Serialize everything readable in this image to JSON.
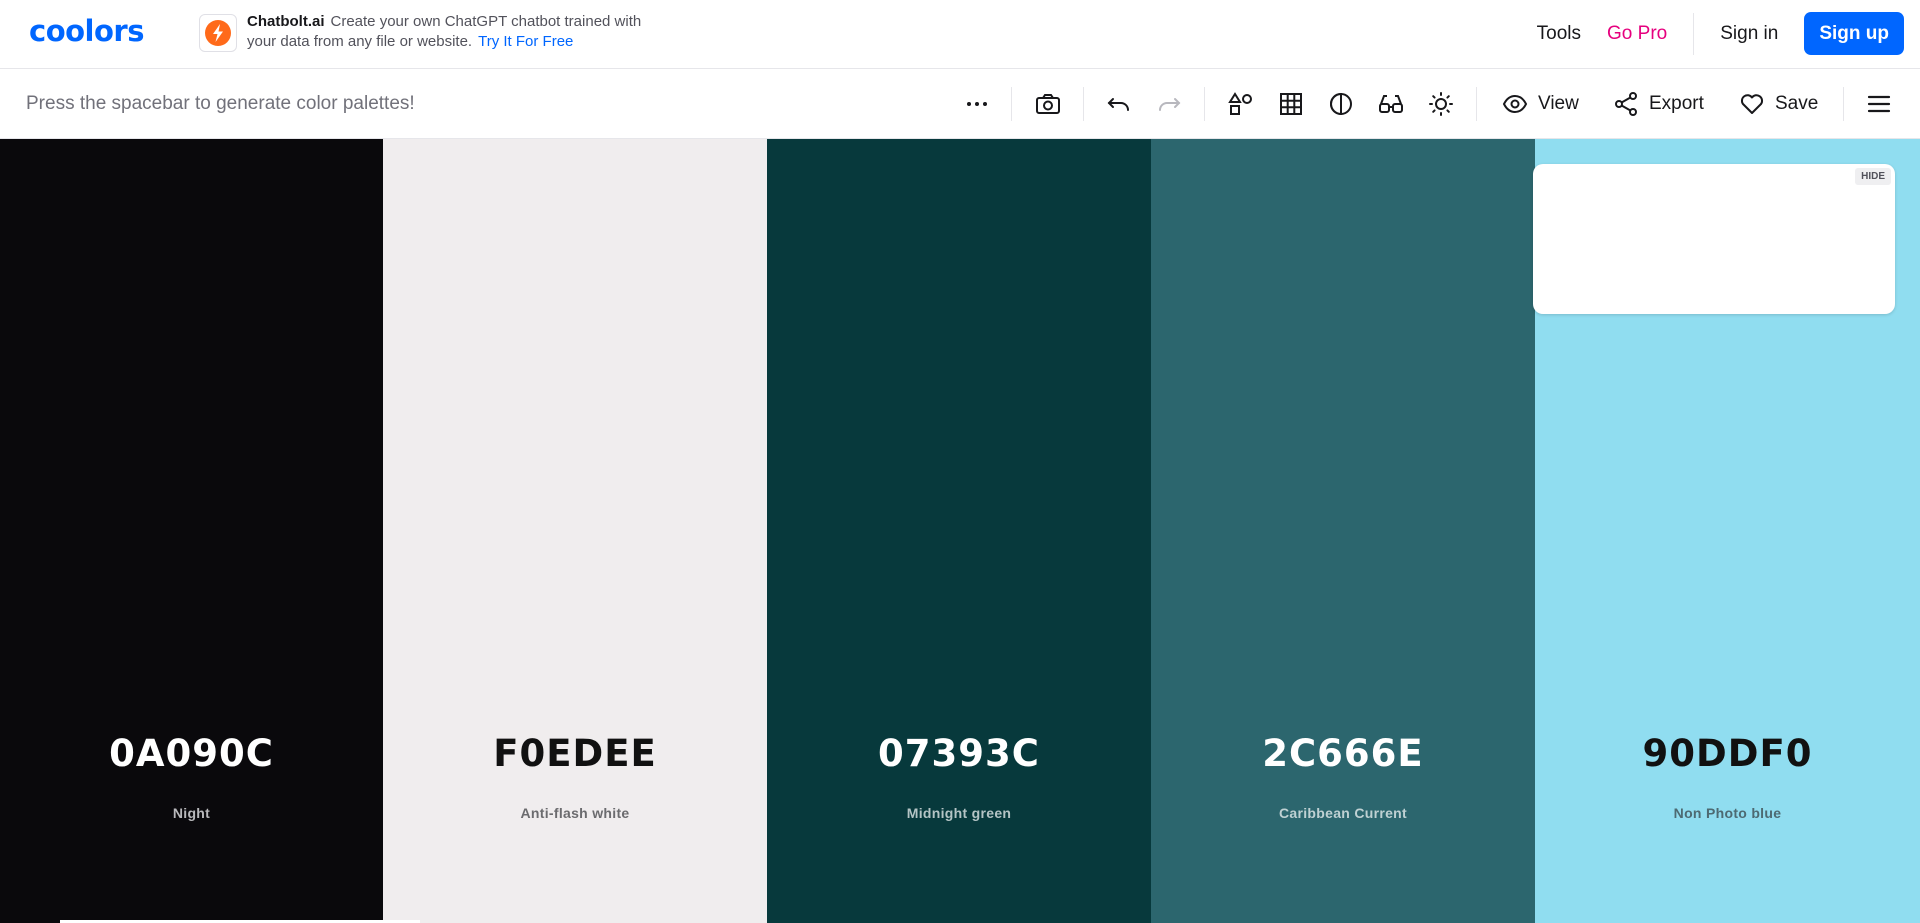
{
  "nav": {
    "logo": "coolors",
    "ad": {
      "brand": "Chatbolt.ai",
      "text": "Create your own ChatGPT chatbot trained with your data from any file or website.",
      "cta": "Try It For Free"
    },
    "tools_label": "Tools",
    "gopro_label": "Go Pro",
    "signin_label": "Sign in",
    "signup_label": "Sign up",
    "accent_color": "#0066ff",
    "pro_color": "#e6007e"
  },
  "toolbar": {
    "hint": "Press the spacebar to generate color palettes!",
    "view_label": "View",
    "export_label": "Export",
    "save_label": "Save",
    "icons": [
      "more-icon",
      "camera-icon",
      "undo-icon",
      "redo-icon",
      "shapes-icon",
      "grid-icon",
      "contrast-icon",
      "glasses-icon",
      "sun-icon",
      "eye-icon",
      "share-icon",
      "heart-icon",
      "menu-icon"
    ]
  },
  "palette": {
    "colors": [
      {
        "hex": "0A090C",
        "name": "Night",
        "bg": "#0a090c",
        "text": "#ffffff",
        "subtext": "#b9b9bc"
      },
      {
        "hex": "F0EDEE",
        "name": "Anti-flash white",
        "bg": "#f0edee",
        "text": "#111111",
        "subtext": "#6b6b6e"
      },
      {
        "hex": "07393C",
        "name": "Midnight green",
        "bg": "#07393c",
        "text": "#ffffff",
        "subtext": "#b4c4c5"
      },
      {
        "hex": "2C666E",
        "name": "Caribbean Current",
        "bg": "#2c666e",
        "text": "#ffffff",
        "subtext": "#bfd1d3"
      },
      {
        "hex": "90DDF0",
        "name": "Non Photo blue",
        "bg": "#90ddf0",
        "text": "#111111",
        "subtext": "#4d6a72"
      }
    ]
  },
  "ad_card": {
    "hide_label": "HIDE"
  }
}
